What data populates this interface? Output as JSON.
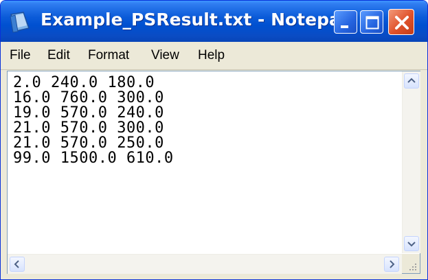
{
  "window": {
    "title": "Example_PSResult.txt - Notepad",
    "accent": "#0a58d8",
    "close_color": "#e0512a"
  },
  "icons": {
    "app": "notepad-icon",
    "minimize": "minimize-icon",
    "maximize": "maximize-icon",
    "close": "close-icon",
    "scroll_up": "chevron-up-icon",
    "scroll_down": "chevron-down-icon",
    "scroll_left": "chevron-left-icon",
    "scroll_right": "chevron-right-icon",
    "grip": "resize-grip-icon"
  },
  "menu": [
    "File",
    "Edit",
    "Format",
    "View",
    "Help"
  ],
  "content": {
    "lines": [
      "2.0 240.0 180.0",
      "16.0 760.0 300.0",
      "19.0 570.0 240.0",
      "21.0 570.0 300.0",
      "21.0 570.0 250.0",
      "99.0 1500.0 610.0"
    ]
  }
}
